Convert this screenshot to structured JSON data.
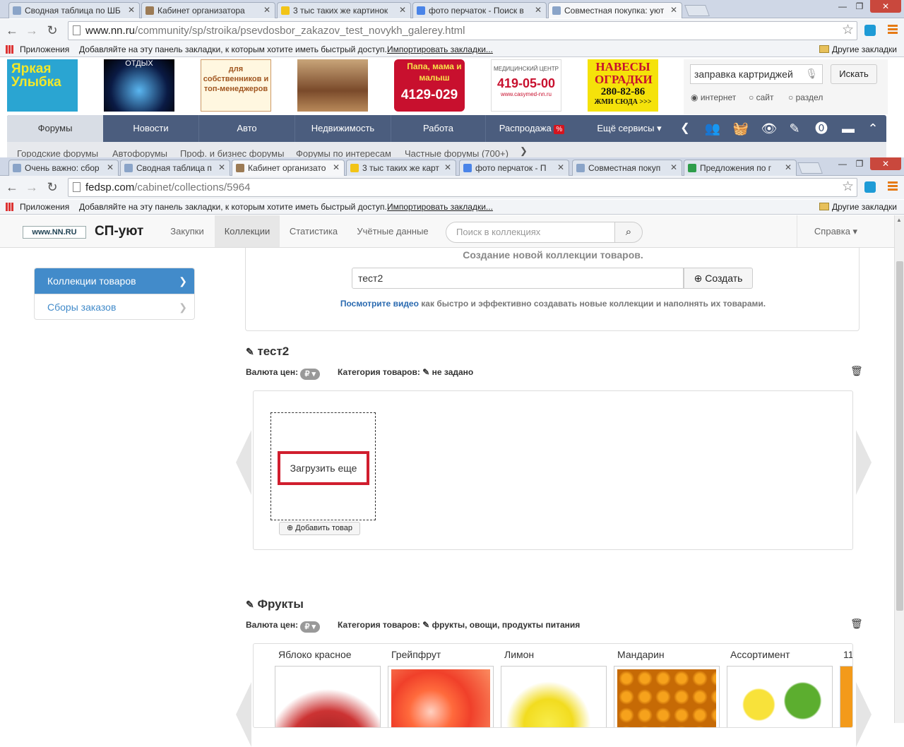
{
  "browser1": {
    "tabs": [
      {
        "label": "Сводная таблица по ШБ"
      },
      {
        "label": "Кабинет организатора"
      },
      {
        "label": "3 тыс таких же картинок"
      },
      {
        "label": "фото перчаток - Поиск в"
      },
      {
        "label": "Совместная покупка: уют"
      }
    ],
    "url_host": "www.nn.ru",
    "url_path": "/community/sp/stroika/psevdosbor_zakazov_test_novykh_galerey.html",
    "bookmarks_apps": "Приложения",
    "bookmarks_hint": "Добавляйте на эту панель закладки, к которым хотите иметь быстрый доступ.",
    "bookmarks_import": "Импортировать закладки...",
    "bookmarks_other": "Другие закладки"
  },
  "nnru": {
    "banners": [
      {
        "line1": "Яркая",
        "line2": "Улыбка"
      },
      {
        "line1": "ОТДЫХ",
        "line2": ""
      },
      {
        "line1": "для",
        "line2": "собственников и топ-менеджеров"
      },
      {
        "line1": "",
        "line2": ""
      },
      {
        "line1": "Папа, мама и малыш",
        "line2": "4129-029"
      },
      {
        "line1": "МЕДИЦИНСКИЙ ЦЕНТР",
        "line2": "419-05-00",
        "line3": "www.casymed-nn.ru"
      },
      {
        "line1": "НАВЕСЫ ОГРАДКИ",
        "line2": "280-82-86",
        "line3": "ЖМИ СЮДА >>>"
      }
    ],
    "search_value": "заправка картриджей",
    "search_button": "Искать",
    "search_options": [
      "интернет",
      "сайт",
      "раздел"
    ],
    "nav": [
      "Форумы",
      "Новости",
      "Авто",
      "Недвижимость",
      "Работа",
      "Распродажа",
      "Ещё сервисы"
    ],
    "sale_badge": "%",
    "subnav": [
      "Городские форумы",
      "Автофорумы",
      "Проф. и бизнес форумы",
      "Форумы по интересам",
      "Частные форумы (700+)"
    ]
  },
  "browser2": {
    "tabs": [
      {
        "label": "Очень важно: сбор"
      },
      {
        "label": "Сводная таблица п"
      },
      {
        "label": "Кабинет организато"
      },
      {
        "label": "3 тыс таких же карт"
      },
      {
        "label": "фото перчаток - П"
      },
      {
        "label": "Совместная покуп"
      },
      {
        "label": "Предложения по г"
      }
    ],
    "url_host": "fedsp.com",
    "url_path": "/cabinet/collections/5964",
    "bookmarks_apps": "Приложения",
    "bookmarks_hint": "Добавляйте на эту панель закладки, к которым хотите иметь быстрый доступ.",
    "bookmarks_import": "Импортировать закладки...",
    "bookmarks_other": "Другие закладки"
  },
  "sp": {
    "logo": "www.NN.RU",
    "brand": "СП-уют",
    "nav": [
      "Закупки",
      "Коллекции",
      "Статистика",
      "Учётные данные"
    ],
    "search_placeholder": "Поиск в коллекциях",
    "help": "Справка",
    "sidebar": [
      {
        "label": "Коллекции товаров"
      },
      {
        "label": "Сборы заказов"
      }
    ],
    "create_heading": "Создание новой коллекции товаров.",
    "create_value": "тест2",
    "create_button": "Создать",
    "video_link": "Посмотрите видео",
    "video_text": "как быстро и эффективно создавать новые коллекции и наполнять их товарами.",
    "currency_label": "Валюта цен:",
    "currency_value": "₽",
    "category_label": "Категория товаров:",
    "collections": [
      {
        "title": "тест2",
        "category": "не задано",
        "load_more": "Загрузить еще",
        "add_item": "Добавить товар"
      },
      {
        "title": "Фрукты",
        "category": "фрукты, овощи, продукты питания",
        "items": [
          {
            "name": "Яблоко красное"
          },
          {
            "name": "Грейпфрут"
          },
          {
            "name": "Лимон"
          },
          {
            "name": "Мандарин"
          },
          {
            "name": "Ассортимент"
          },
          {
            "name": "11"
          }
        ]
      }
    ]
  }
}
